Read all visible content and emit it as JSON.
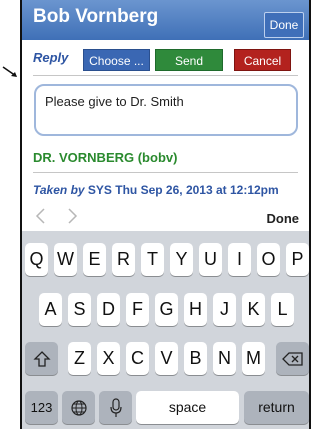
{
  "header": {
    "title": "Bob Vornberg",
    "done_label": "Done"
  },
  "reply_bar": {
    "label": "Reply",
    "choose_label": "Choose ...",
    "send_label": "Send",
    "cancel_label": "Cancel"
  },
  "message": {
    "text": "Please give to Dr. Smith"
  },
  "sender": "DR. VORNBERG (bobv)",
  "taken": {
    "label": "Taken by",
    "value": "SYS Thu Sep 26, 2013 at 12:12pm"
  },
  "accessory": {
    "done_label": "Done"
  },
  "keyboard": {
    "row1": [
      "Q",
      "W",
      "E",
      "R",
      "T",
      "Y",
      "U",
      "I",
      "O",
      "P"
    ],
    "row2": [
      "A",
      "S",
      "D",
      "F",
      "G",
      "H",
      "J",
      "K",
      "L"
    ],
    "row3": [
      "Z",
      "X",
      "C",
      "V",
      "B",
      "N",
      "M"
    ],
    "numbers_label": "123",
    "space_label": "space",
    "return_label": "return"
  },
  "colors": {
    "nav_bar": "#4a7cc1",
    "reply": "#2e55a3",
    "send": "#2f8a3b",
    "cancel": "#b3221e",
    "sender": "#2a8a2e"
  },
  "icons": {
    "pointer": "arrow-icon",
    "previous": "chevron-left-icon",
    "next": "chevron-right-icon",
    "shift": "shift-icon",
    "delete": "backspace-icon",
    "globe": "globe-icon",
    "microphone": "microphone-icon"
  }
}
